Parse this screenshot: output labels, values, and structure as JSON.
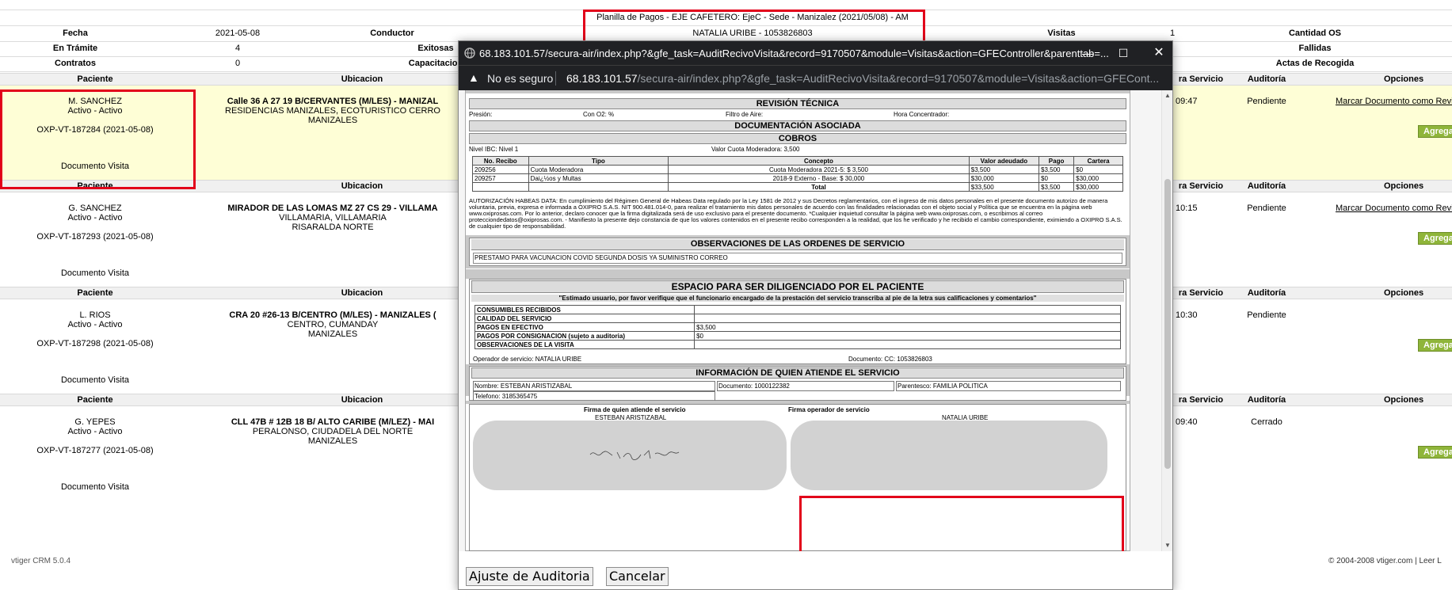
{
  "header": {
    "title": "Planilla de Pagos - EJE CAFETERO: EjeC - Sede - Manizalez (2021/05/08) - AM",
    "operator_line": "NATALIA URIBE - 1053826803",
    "fecha_label": "Fecha",
    "fecha_value": "2021-05-08",
    "conductor_label": "Conductor",
    "visitas_label": "Visitas",
    "visitas_value": "1",
    "cantidad_label": "Cantidad OS",
    "tramite_label": "En Trámite",
    "tramite_value": "4",
    "exitosas_label": "Exitosas",
    "fallidas_label": "Fallidas",
    "contratos_label": "Contratos",
    "contratos_value": "0",
    "capacitacion_label": "Capacitacion",
    "actas_label": "Actas de Recogida"
  },
  "columns": {
    "paciente": "Paciente",
    "ubicacion": "Ubicacion",
    "hora": "ra Servicio",
    "auditoria": "Auditoría",
    "opciones": "Opciones"
  },
  "records": [
    {
      "name": "M. SANCHEZ",
      "status": "Activo - Activo",
      "code": "OXP-VT-187284 (2021-05-08)",
      "doc": "Documento Visita",
      "ubi1": "Calle 36 A 27 19 B/CERVANTES (M/LES) - MANIZAL",
      "ubi2": "RESIDENCIAS MANIZALES, ECOTURISTICO CERRO",
      "ubi3": "MANIZALES",
      "hora": "09:47",
      "auditoria": "Pendiente",
      "link": "Marcar Documento como Revi",
      "agregar": "Agrega"
    },
    {
      "name": "G. SANCHEZ",
      "status": "Activo - Activo",
      "code": "OXP-VT-187293 (2021-05-08)",
      "doc": "Documento Visita",
      "ubi1": "MIRADOR DE LAS LOMAS MZ 27 CS 29 - VILLAMA",
      "ubi2": "VILLAMARIA, VILLAMARIA",
      "ubi3": "RISARALDA NORTE",
      "hora": "10:15",
      "auditoria": "Pendiente",
      "link": "Marcar Documento como Revi",
      "agregar": "Agrega"
    },
    {
      "name": "L. RIOS",
      "status": "Activo - Activo",
      "code": "OXP-VT-187298 (2021-05-08)",
      "doc": "Documento Visita",
      "ubi1": "CRA 20 #26-13 B/CENTRO (M/LES) - MANIZALES (",
      "ubi2": "CENTRO, CUMANDAY",
      "ubi3": "MANIZALES",
      "hora": "10:30",
      "auditoria": "Pendiente",
      "link": "",
      "agregar": "Agrega"
    },
    {
      "name": "G. YEPES",
      "status": "Activo - Activo",
      "code": "OXP-VT-187277 (2021-05-08)",
      "doc": "Documento Visita",
      "ubi1": "CLL 47B # 12B 18 B/ ALTO CARIBE (M/LEZ) - MAI",
      "ubi2": "PERALONSO, CIUDADELA DEL NORTE",
      "ubi3": "MANIZALES",
      "hora": "09:40",
      "auditoria": "Cerrado",
      "link": "",
      "agregar": "Agrega"
    }
  ],
  "footer": {
    "left": "vtiger CRM 5.0.4",
    "right": "© 2004-2008 vtiger.com | Leer L"
  },
  "popup": {
    "window_title": "68.183.101.57/secura-air/index.php?&gfe_task=AuditRecivoVisita&record=9170507&module=Visitas&action=GFEController&parenttab=...",
    "not_secure": "No es seguro",
    "url_host": "68.183.101.57",
    "url_path": "/secura-air/index.php?&gfe_task=AuditRecivoVisita&record=9170507&module=Visitas&action=GFECont...",
    "revision": "REVISIÓN TÉCNICA",
    "presion": "Presión:",
    "con_o2": "Con O2: %",
    "filtro": "Filtro de Aire:",
    "hora_conc": "Hora Concentrador:",
    "doc_asoc": "DOCUMENTACIÓN ASOCIADA",
    "cobros": "COBROS",
    "nivel_ibc": "Nivel IBC: Nivel 1",
    "valor_cuota": "Valor Cuota Moderadora: 3,500",
    "cobros_headers": [
      "No. Recibo",
      "Tipo",
      "Concepto",
      "Valor adeudado",
      "Pago",
      "Cartera"
    ],
    "cobros_rows": [
      [
        "209256",
        "Cuota Moderadora",
        "Cuota Moderadora 2021-5: $ 3,500",
        "$3,500",
        "$3,500",
        "$0"
      ],
      [
        "209257",
        "Dai¿½os y Multas",
        "2018-9 Externo - Base: $ 30,000",
        "$30,000",
        "$0",
        "$30,000"
      ]
    ],
    "cobros_total": [
      "Total",
      "$33,500",
      "$3,500",
      "$30,000"
    ],
    "habeas": "AUTORIZACIÓN HABEAS DATA: En cumplimiento del Régimen General de Habeas Data regulado por la Ley 1581 de 2012 y sus Decretos reglamentarios, con el ingreso de mis datos personales en el presente documento autorizo de manera voluntaria, previa, expresa e informada a OXIPRO S.A.S. NIT 900.481.014-0, para realizar el tratamiento mis datos personales de acuerdo con las finalidades relacionadas con el objeto social y Política que se encuentra en la página web www.oxiprosas.com. Por lo anterior, declaro conocer que la firma digitalizada será de uso exclusivo para el presente documento. *Cualquier inquietud consultar la página web www.oxiprosas.com, o escribirnos al correo protecciondedatos@oxiprosas.com. - Manifiesto la presente dejo constancia de que los valores contenidos en el presente recibo corresponden a la realidad, que los he verificado y he recibido el cambio correspondiente, eximiendo a OXIPRO S.A.S. de cualquier tipo de responsabilidad.",
    "obs_title": "OBSERVACIONES DE LAS ORDENES DE SERVICIO",
    "obs_text": "PRESTAMO PARA VACUNACION COVID SEGUNDA DOSIS YA SUMINISTRO CORREO",
    "espacio_title": "ESPACIO PARA SER DILIGENCIADO POR EL PACIENTE",
    "espacio_sub": "\"Estimado usuario, por favor verifique que el funcionario encargado de la prestación del servicio transcriba al pie de la letra sus calificaciones y comentarios\"",
    "espacio_rows": [
      [
        "CONSUMIBLES RECIBIDOS",
        ""
      ],
      [
        "CALIDAD DEL SERVICIO",
        ""
      ],
      [
        "PAGOS EN EFECTIVO",
        "$3,500"
      ],
      [
        "PAGOS POR CONSIGNACION (sujeto a auditoria)",
        "$0"
      ],
      [
        "OBSERVACIONES DE LA VISITA",
        ""
      ]
    ],
    "operador": "Operador de servicio: NATALIA URIBE",
    "documento": "Documento: CC: 1053826803",
    "info_title": "INFORMACIÓN DE QUIEN ATIENDE EL SERVICIO",
    "info_nombre": "Nombre: ESTEBAN ARISTIZABAL",
    "info_doc": "Documento: 1000122382",
    "info_parentesco": "Parentesco: FAMILIA POLITICA",
    "info_tel": "Telefono: 3185365475",
    "firma1_label": "Firma de quien atiende el servicio",
    "firma1_name": "ESTEBAN ARISTIZABAL",
    "firma2_label": "Firma operador de servicio",
    "firma2_name": "NATALIA URIBE",
    "btn_ajuste": "Ajuste de Auditoria",
    "btn_cancelar": "Cancelar"
  },
  "colors": {
    "accent_red": "#e2001a",
    "row_highlight": "#fefed6",
    "add_button": "#8fb53a"
  }
}
